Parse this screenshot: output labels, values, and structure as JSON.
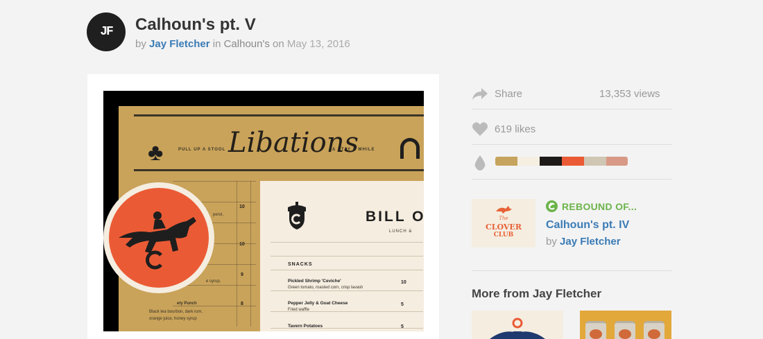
{
  "header": {
    "avatar_mark": "JF",
    "title": "Calhoun's pt. V",
    "by_word": "by",
    "author": "Jay Fletcher",
    "in_word": "in",
    "team": "Calhoun's",
    "on_word": "on",
    "date": "May 13, 2016"
  },
  "shot": {
    "menu_heading": "Libations",
    "menu_left_caption": "PULL UP A STOOL",
    "menu_right_caption": "& STAY A WHILE",
    "paper_title": "BILL O",
    "paper_subtitle": "LUNCH &",
    "section": "SNACKS",
    "items": [
      {
        "name": "Pickled Shrimp 'Ceviche'",
        "desc": "Green tomato, roasted corn, crisp lavash",
        "price": "10"
      },
      {
        "name": "Pepper Jelly & Goat Cheese",
        "desc": "Fried waffle",
        "price": "5"
      },
      {
        "name": "Tavern Potatoes",
        "desc": "",
        "price": "5"
      }
    ],
    "left_prices": [
      "10",
      "10",
      "9",
      "8"
    ],
    "left_texts": [
      "LS",
      "perol,",
      "e syrup,",
      "ety Punch",
      "Black tea bourbon, dark rum,",
      "orange juice, honey syrup"
    ]
  },
  "sidebar": {
    "share_label": "Share",
    "views": "13,353 views",
    "likes": "619 likes",
    "palette": [
      "#c6a45e",
      "#f5efe2",
      "#1e1a17",
      "#ea5b35",
      "#d0c6b4",
      "#d89a86"
    ],
    "rebound": {
      "label": "REBOUND OF...",
      "title": "Calhoun's pt. IV",
      "by_word": "by",
      "author": "Jay Fletcher",
      "thumb_line1": "The",
      "thumb_line2": "CLOVER",
      "thumb_line3": "CLUB"
    },
    "more_heading": "More from Jay Fletcher"
  },
  "colors": {
    "link": "#3a7bb5",
    "rebound_green": "#6bb44a",
    "muted": "#999999"
  }
}
